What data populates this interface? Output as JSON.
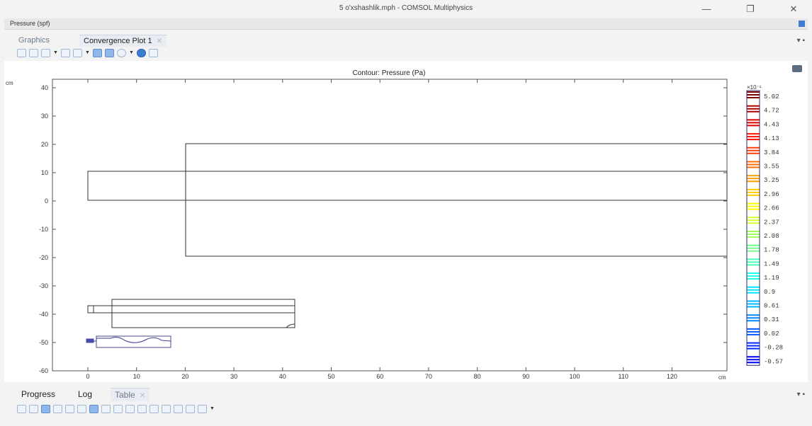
{
  "window": {
    "title": "5 o'xshashlik.mph - COMSOL Multiphysics",
    "minimize": "—",
    "restore": "❐",
    "close": "✕"
  },
  "subbar": {
    "label": "Pressure (spf)"
  },
  "tabs": [
    {
      "label": "Graphics",
      "active": false
    },
    {
      "label": "Convergence Plot 1",
      "active": true,
      "close": "✕"
    }
  ],
  "tabs_menu": "▾ ▪",
  "toolbar_icons": [
    "zoom-in-icon",
    "zoom-out-icon",
    "zoom-box-icon",
    "caret-icon",
    "zoom-extents-icon",
    "axis-icon",
    "caret-icon",
    "select-icon",
    "select-all-icon",
    "settings-icon",
    "caret-icon",
    "cloud-icon",
    "save-image-icon"
  ],
  "plot": {
    "title": "Contour: Pressure (Pa)",
    "y_unit": "cm",
    "x_unit": "cm",
    "y_ticks": [
      "40",
      "30",
      "20",
      "10",
      "0",
      "-10",
      "-20",
      "-30",
      "-40",
      "-50",
      "-60"
    ],
    "x_ticks": [
      "0",
      "10",
      "20",
      "30",
      "40",
      "50",
      "60",
      "70",
      "80",
      "90",
      "100",
      "110",
      "120"
    ],
    "colorbar": {
      "exponent": "×10⁻¹",
      "labels": [
        "5.02",
        "4.72",
        "4.43",
        "4.13",
        "3.84",
        "3.55",
        "3.25",
        "2.96",
        "2.66",
        "2.37",
        "2.08",
        "1.78",
        "1.49",
        "1.19",
        "0.9",
        "0.61",
        "0.31",
        "0.02",
        "-0.28",
        "-0.57"
      ]
    }
  },
  "bottom_tabs": [
    {
      "label": "Progress",
      "active": false
    },
    {
      "label": "Log",
      "active": false
    },
    {
      "label": "Table",
      "active": true,
      "close": "✕"
    }
  ],
  "bottom_menu": "▾ ▪",
  "accent": "#3f7bd1"
}
